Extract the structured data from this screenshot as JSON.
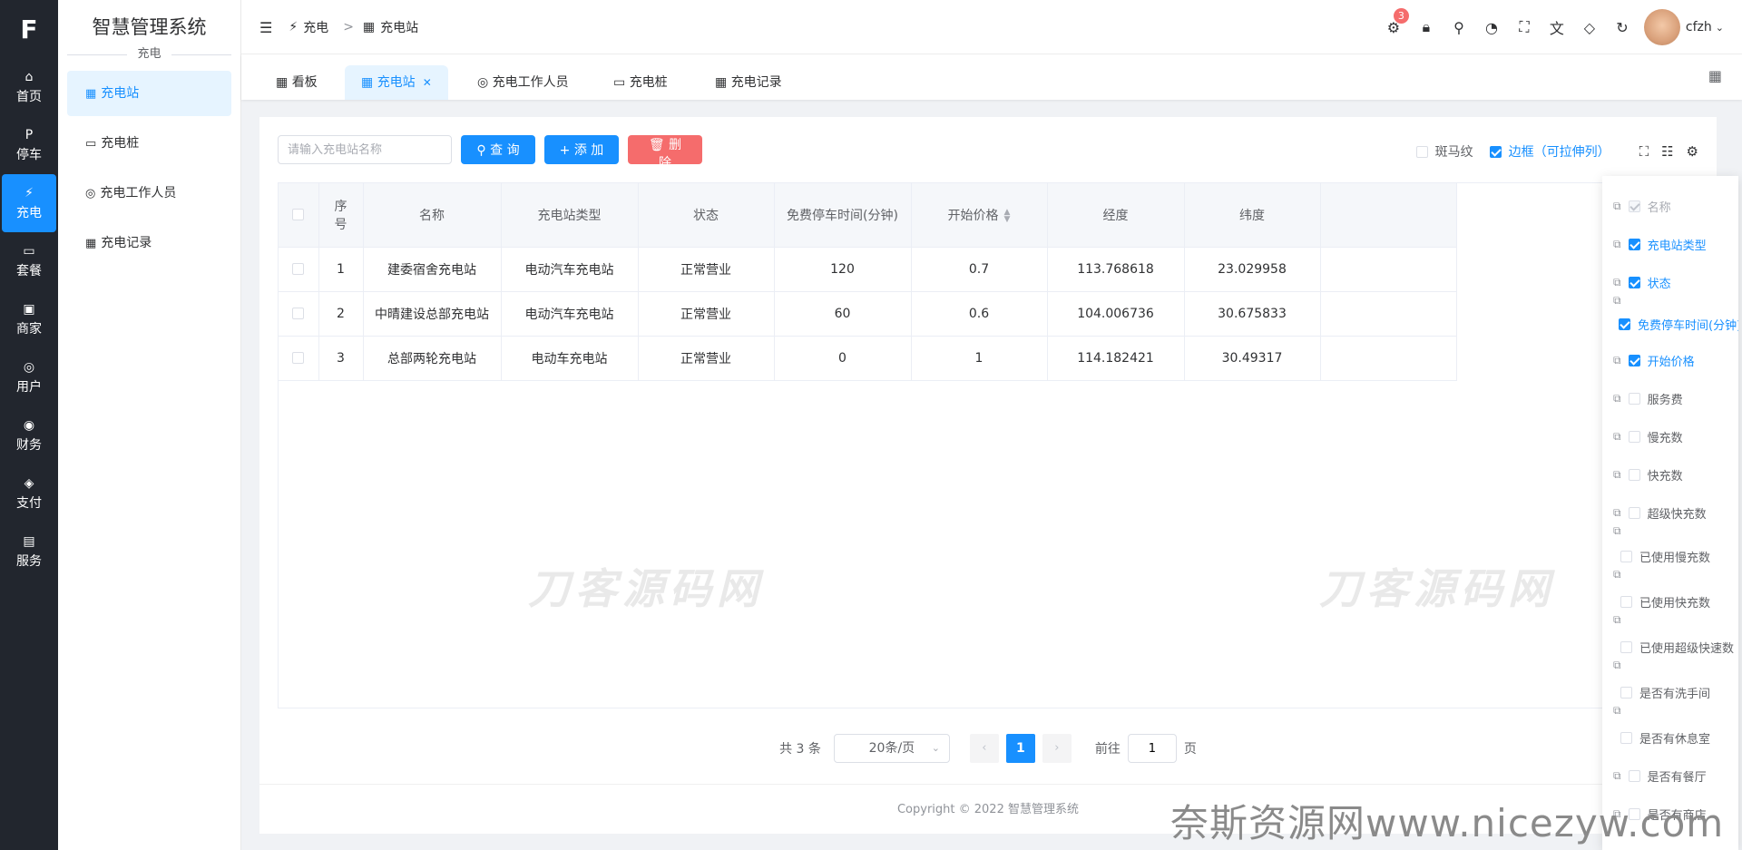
{
  "rail": {
    "logo": "F",
    "items": [
      {
        "icon": "⌂",
        "label": "首页"
      },
      {
        "icon": "P",
        "label": "停车"
      },
      {
        "icon": "⚡",
        "label": "充电"
      },
      {
        "icon": "▭",
        "label": "套餐"
      },
      {
        "icon": "▣",
        "label": "商家"
      },
      {
        "icon": "◎",
        "label": "用户"
      },
      {
        "icon": "◉",
        "label": "财务"
      },
      {
        "icon": "◈",
        "label": "支付"
      },
      {
        "icon": "▤",
        "label": "服务"
      }
    ]
  },
  "sidebar": {
    "title": "智慧管理系统",
    "section": "充电",
    "items": [
      {
        "icon": "▦",
        "label": "充电站"
      },
      {
        "icon": "▭",
        "label": "充电桩"
      },
      {
        "icon": "◎",
        "label": "充电工作人员"
      },
      {
        "icon": "▦",
        "label": "充电记录"
      }
    ]
  },
  "breadcrumb": {
    "parent": "充电",
    "current": "充电站"
  },
  "header": {
    "badge": "3",
    "username": "cfzh"
  },
  "tabs": [
    {
      "label": "看板"
    },
    {
      "label": "充电站"
    },
    {
      "label": "充电工作人员"
    },
    {
      "label": "充电桩"
    },
    {
      "label": "充电记录"
    }
  ],
  "toolbar": {
    "search_placeholder": "请输入充电站名称",
    "query": "查 询",
    "add": "添 加",
    "delete": "删 除",
    "stripe": "斑马纹",
    "border": "边框（可拉伸列）"
  },
  "table": {
    "headers": [
      "序号",
      "名称",
      "充电站类型",
      "状态",
      "免费停车时间(分钟)",
      "开始价格",
      "经度",
      "纬度"
    ],
    "rows": [
      [
        "1",
        "建委宿舍充电站",
        "电动汽车充电站",
        "正常营业",
        "120",
        "0.7",
        "113.768618",
        "23.029958"
      ],
      [
        "2",
        "中晴建设总部充电站",
        "电动汽车充电站",
        "正常营业",
        "60",
        "0.6",
        "104.006736",
        "30.675833"
      ],
      [
        "3",
        "总部两轮充电站",
        "电动车充电站",
        "正常营业",
        "0",
        "1",
        "114.182421",
        "30.49317"
      ]
    ]
  },
  "watermark": "刀客源码网",
  "pagination": {
    "total": "共 3 条",
    "page_size": "20条/页",
    "current": "1",
    "goto": "前往",
    "goto_value": "1",
    "page_unit": "页"
  },
  "footer": "Copyright © 2022 智慧管理系统",
  "column_panel": [
    {
      "label": "名称",
      "state": "disabled"
    },
    {
      "label": "充电站类型",
      "state": "on"
    },
    {
      "label": "状态",
      "state": "on"
    },
    {
      "label": "免费停车时间(分钟)",
      "state": "on"
    },
    {
      "label": "开始价格",
      "state": "on"
    },
    {
      "label": "服务费",
      "state": "off"
    },
    {
      "label": "慢充数",
      "state": "off"
    },
    {
      "label": "快充数",
      "state": "off"
    },
    {
      "label": "超级快充数",
      "state": "off"
    },
    {
      "label": "已使用慢充数",
      "state": "off"
    },
    {
      "label": "已使用快充数",
      "state": "off"
    },
    {
      "label": "已使用超级快速数",
      "state": "off"
    },
    {
      "label": "是否有洗手间",
      "state": "off"
    },
    {
      "label": "是否有休息室",
      "state": "off"
    },
    {
      "label": "是否有餐厅",
      "state": "off"
    },
    {
      "label": "是否有商店",
      "state": "off"
    }
  ],
  "site_watermark": "奈斯资源网www.nicezyw.com"
}
